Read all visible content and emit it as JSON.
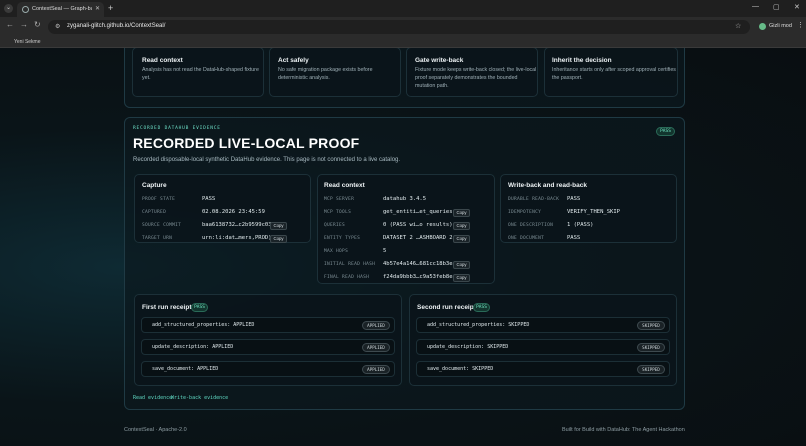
{
  "browser": {
    "tab_title": "ContextSeal — Graph-backed",
    "url": "zyganali-glitch.github.io/ContextSeal/",
    "profile_label": "Gizli mod",
    "bookmark": "Yeni Sekme"
  },
  "gates": [
    {
      "title": "Read context",
      "desc": "Analysis has not read the DataHub-shaped fixture yet."
    },
    {
      "title": "Act safely",
      "desc": "No safe migration package exists before deterministic analysis."
    },
    {
      "title": "Gate write-back",
      "desc": "Fixture mode keeps write-back closed; the live-local proof separately demonstrates the bounded mutation path."
    },
    {
      "title": "Inherit the decision",
      "desc": "Inheritance starts only after scoped approval certifies the passport."
    }
  ],
  "proof": {
    "kicker": "RECORDED DATAHUB EVIDENCE",
    "status": "PASS",
    "title": "RECORDED LIVE-LOCAL PROOF",
    "subtitle": "Recorded disposable-local synthetic DataHub evidence. This page is not connected to a live catalog.",
    "copy_label": "Copy"
  },
  "capture": {
    "title": "Capture",
    "rows": [
      {
        "label": "PROOF STATE",
        "value": "PASS"
      },
      {
        "label": "CAPTURED",
        "value": "02.08.2026 23:45:59"
      },
      {
        "label": "SOURCE COMMIT",
        "value": "baa6138732…c2b9599c03"
      },
      {
        "label": "TARGET URN",
        "value": "urn:li:dat…mers,PROD)"
      }
    ]
  },
  "read_context": {
    "title": "Read context",
    "rows": [
      {
        "label": "MCP SERVER",
        "value": "datahub 3.4.5"
      },
      {
        "label": "MCP TOOLS",
        "value": "get_entiti…et_queries"
      },
      {
        "label": "QUERIES",
        "value": "0 (PASS wi…o results)"
      },
      {
        "label": "ENTITY TYPES",
        "value": "DATASET 2 …ASHBOARD 2"
      },
      {
        "label": "MAX HOPS",
        "value": "5"
      },
      {
        "label": "INITIAL READ HASH",
        "value": "4b57e4a146…681cc18b3e"
      },
      {
        "label": "FINAL READ HASH",
        "value": "f24da9bbb3…c9a53feb8e"
      }
    ]
  },
  "writeback": {
    "title": "Write-back and read-back",
    "rows": [
      {
        "label": "DURABLE READ-BACK",
        "value": "PASS"
      },
      {
        "label": "IDEMPOTENCY",
        "value": "VERIFY_THEN_SKIP"
      },
      {
        "label": "ONE DESCRIPTION",
        "value": "1 (PASS)"
      },
      {
        "label": "ONE DOCUMENT",
        "value": "PASS"
      }
    ]
  },
  "first_run": {
    "title": "First run receipts",
    "badge": "PASS",
    "rows": [
      {
        "text": "add_structured_properties: APPLIED",
        "status": "APPLIED"
      },
      {
        "text": "update_description: APPLIED",
        "status": "APPLIED"
      },
      {
        "text": "save_document: APPLIED",
        "status": "APPLIED"
      }
    ]
  },
  "second_run": {
    "title": "Second run receipts",
    "badge": "PASS",
    "rows": [
      {
        "text": "add_structured_properties: SKIPPED",
        "status": "SKIPPED"
      },
      {
        "text": "update_description: SKIPPED",
        "status": "SKIPPED"
      },
      {
        "text": "save_document: SKIPPED",
        "status": "SKIPPED"
      }
    ]
  },
  "links": {
    "read_evidence": "Read evidence",
    "writeback_evidence": "Write-back evidence"
  },
  "footer": {
    "left": "ContextSeal · Apache-2.0",
    "right": "Built for Build with DataHub: The Agent Hackathon"
  }
}
